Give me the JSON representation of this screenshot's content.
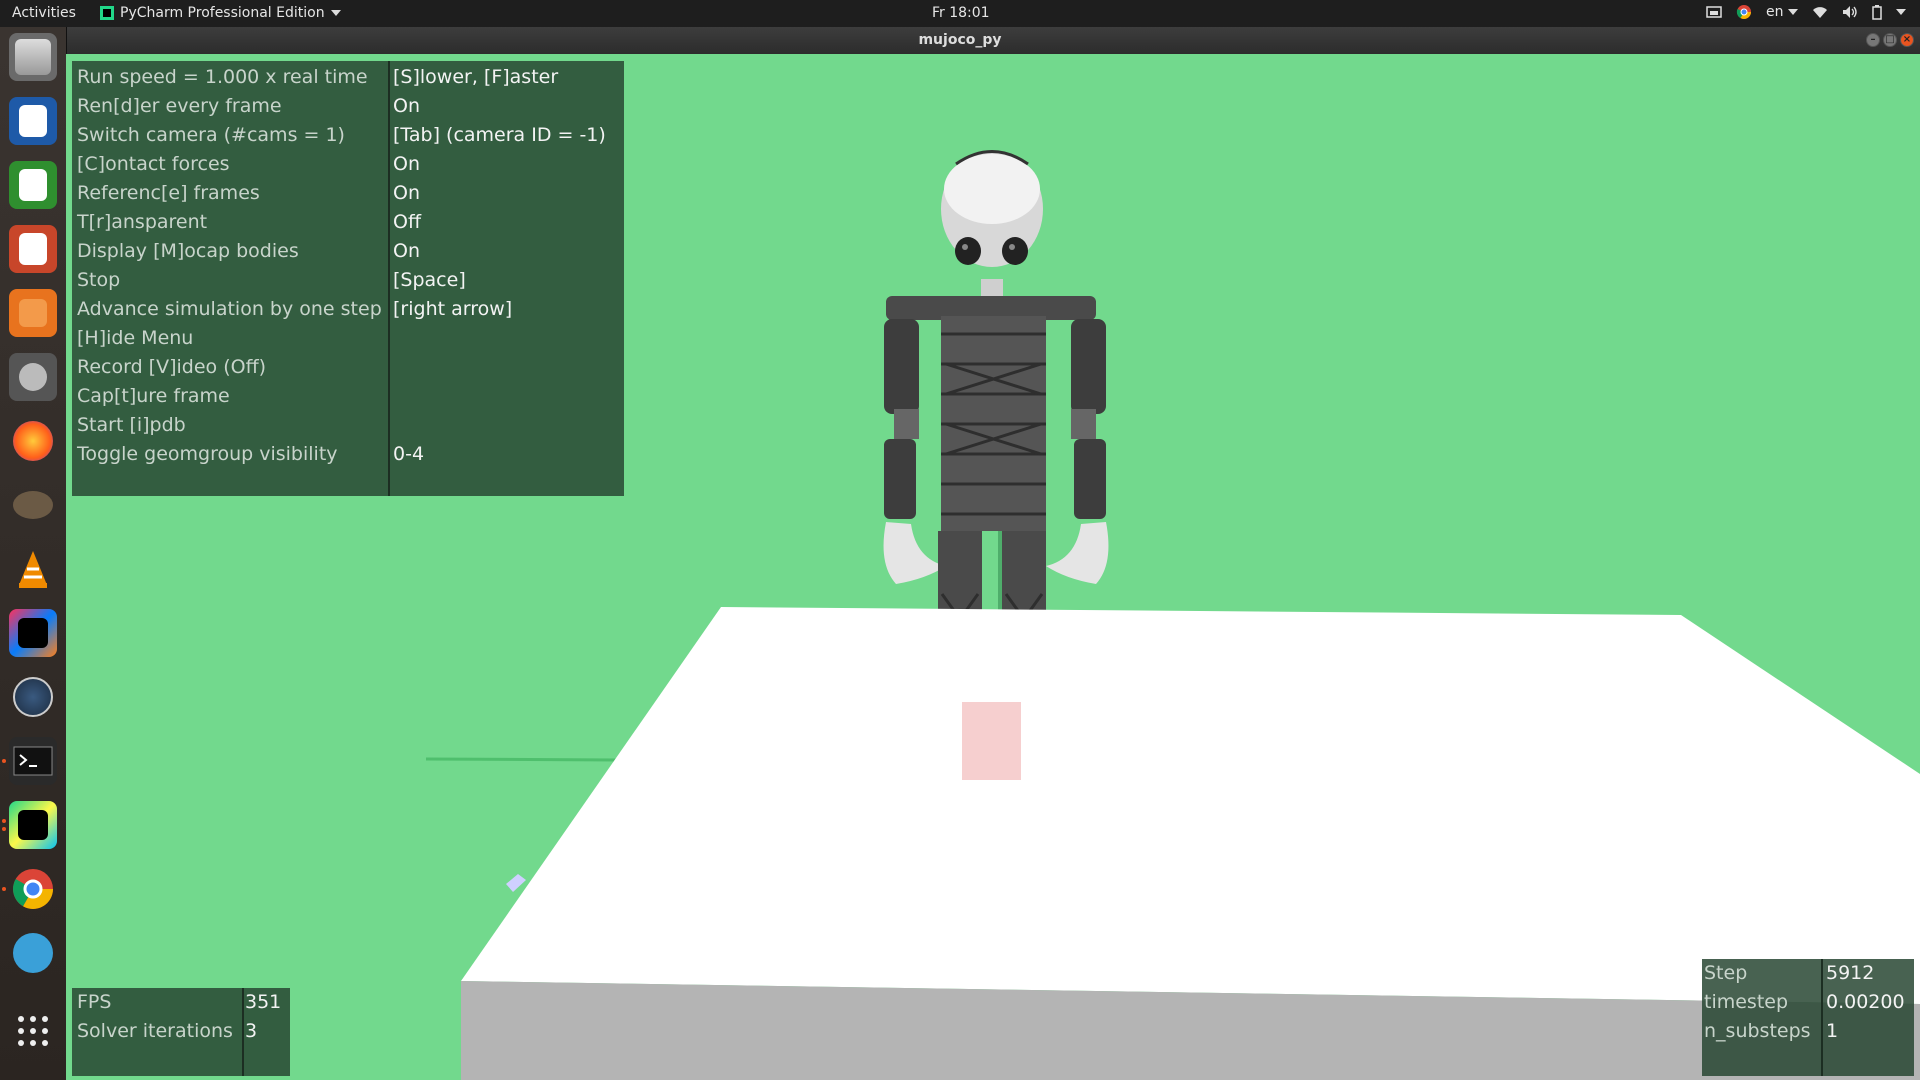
{
  "topbar": {
    "activities": "Activities",
    "app_name": "PyCharm Professional Edition",
    "clock": "Fr 18:01",
    "language": "en"
  },
  "window": {
    "title": "mujoco_py"
  },
  "launcher": {
    "icons": [
      "files-icon",
      "writer-icon",
      "calc-icon",
      "impress-icon",
      "software-center-icon",
      "system-settings-icon",
      "firefox-icon",
      "gimp-icon",
      "vlc-icon",
      "intellij-icon",
      "disk-usage-icon",
      "terminal-icon",
      "pycharm-icon",
      "chrome-icon",
      "thunderbird-icon",
      "show-apps-icon"
    ]
  },
  "menu": {
    "rows": [
      {
        "label": "Run speed = 1.000 x real time",
        "value": "[S]lower, [F]aster"
      },
      {
        "label": "Ren[d]er every frame",
        "value": "On"
      },
      {
        "label": "Switch camera (#cams = 1)",
        "value": "[Tab] (camera ID = -1)"
      },
      {
        "label": "[C]ontact forces",
        "value": "On"
      },
      {
        "label": "Referenc[e] frames",
        "value": "On"
      },
      {
        "label": "T[r]ansparent",
        "value": "Off"
      },
      {
        "label": "Display [M]ocap bodies",
        "value": "On"
      },
      {
        "label": "Stop",
        "value": "[Space]"
      },
      {
        "label": "Advance simulation by one step",
        "value": "[right arrow]"
      },
      {
        "label": "[H]ide Menu",
        "value": ""
      },
      {
        "label": "Record [V]ideo (Off)",
        "value": ""
      },
      {
        "label": "Cap[t]ure frame",
        "value": ""
      },
      {
        "label": "Start [i]pdb",
        "value": ""
      },
      {
        "label": "Toggle geomgroup visibility",
        "value": "0-4"
      }
    ]
  },
  "fps_panel": {
    "rows": [
      {
        "label": "FPS",
        "value": "351"
      },
      {
        "label": "Solver iterations",
        "value": "3"
      }
    ]
  },
  "step_panel": {
    "rows": [
      {
        "label": "Step",
        "value": "5912"
      },
      {
        "label": "timestep",
        "value": "0.00200"
      },
      {
        "label": "n_substeps",
        "value": "1"
      }
    ]
  },
  "colors": {
    "sky": "#72d98d",
    "table_top": "#ffffff",
    "table_side": "#b4b4b4",
    "panel_bg": "#284632",
    "accent": "#e95420"
  }
}
